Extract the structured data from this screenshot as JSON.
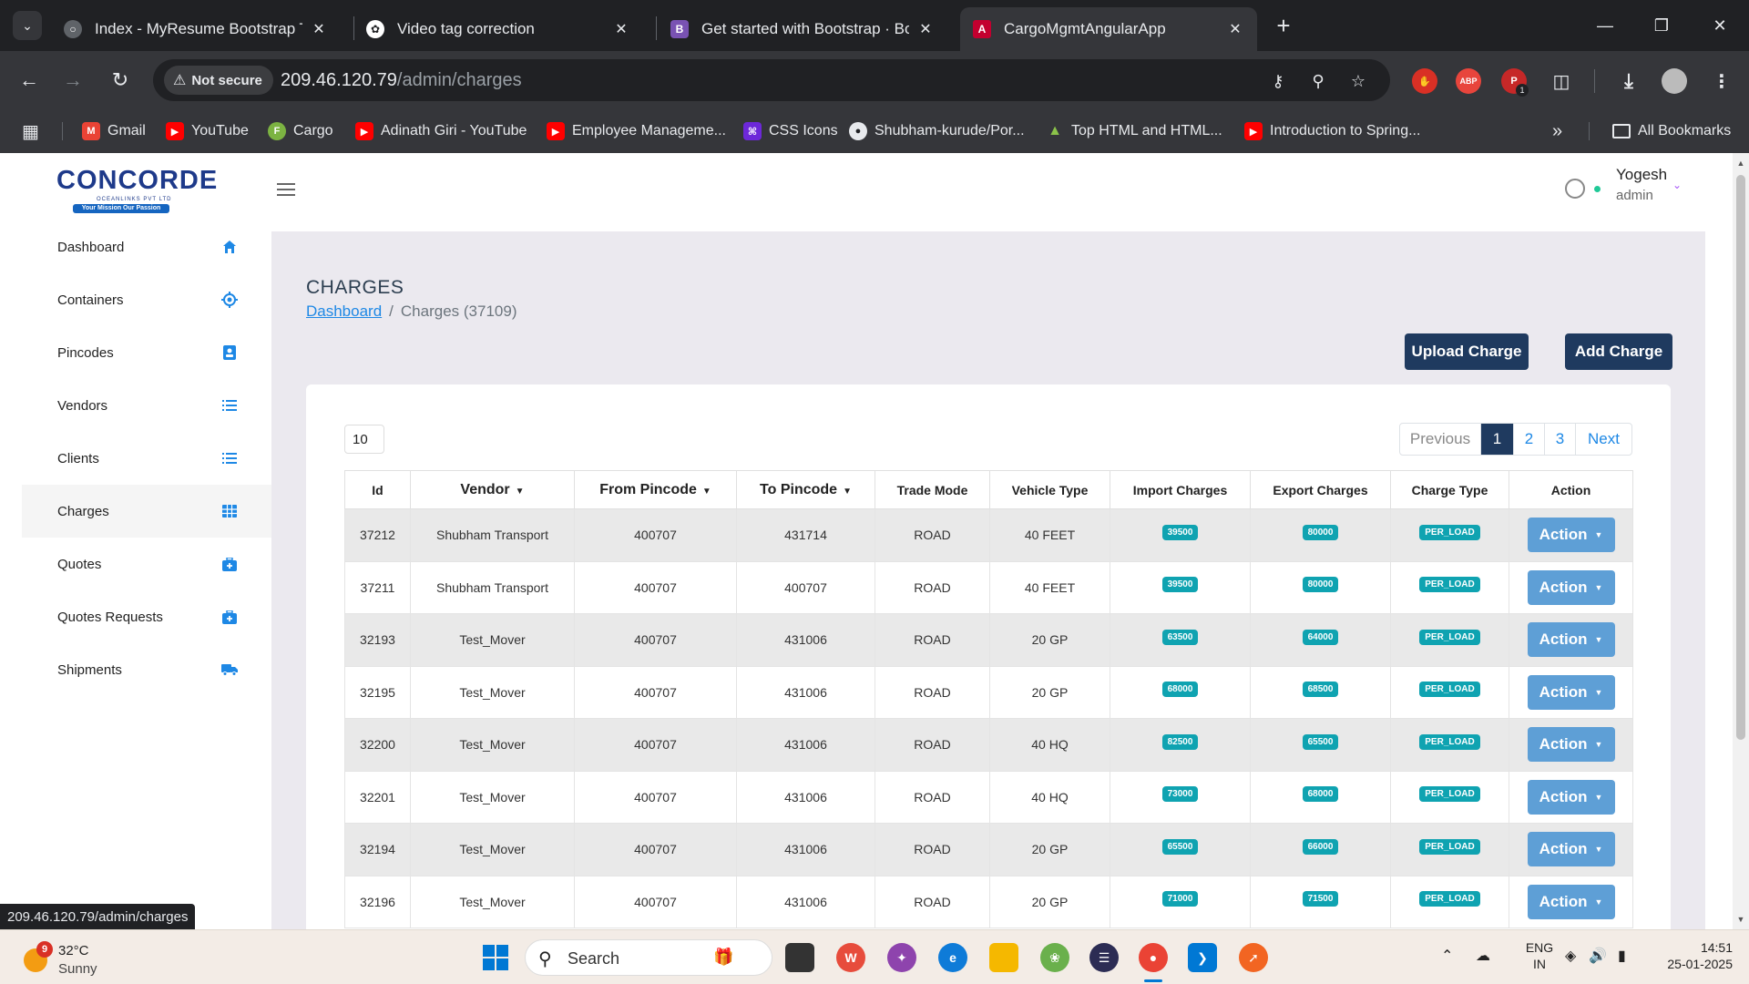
{
  "browser": {
    "tabs": [
      {
        "title": "Index - MyResume Bootstrap Temp",
        "active": false
      },
      {
        "title": "Video tag correction",
        "active": false
      },
      {
        "title": "Get started with Bootstrap · Bootst",
        "active": false
      },
      {
        "title": "CargoMgmtAngularApp",
        "active": true
      }
    ],
    "security_label": "Not secure",
    "url_host": "209.46.120.79",
    "url_path": "/admin/charges",
    "bookmarks": [
      "Gmail",
      "YouTube",
      "Cargo",
      "Adinath Giri - YouTube",
      "Employee Manageme...",
      "CSS Icons",
      "Shubham-kurude/Por...",
      "Top HTML and HTML...",
      "Introduction to Spring..."
    ],
    "all_bookmarks": "All Bookmarks",
    "extensions": {
      "abp": "ABP",
      "badge": "1"
    },
    "status_url": "209.46.120.79/admin/charges"
  },
  "app": {
    "logo": {
      "word": "CONCORDE",
      "sub": "OCEANLINKS PVT LTD",
      "tagline": "Your Mission Our Passion"
    },
    "user": {
      "name": "Yogesh",
      "role": "admin"
    },
    "sidebar": [
      {
        "label": "Dashboard",
        "icon": "home-icon"
      },
      {
        "label": "Containers",
        "icon": "target-icon"
      },
      {
        "label": "Pincodes",
        "icon": "contact-card-icon"
      },
      {
        "label": "Vendors",
        "icon": "list-icon"
      },
      {
        "label": "Clients",
        "icon": "list-icon"
      },
      {
        "label": "Charges",
        "icon": "table-icon",
        "active": true
      },
      {
        "label": "Quotes",
        "icon": "briefcase-plus-icon"
      },
      {
        "label": "Quotes Requests",
        "icon": "briefcase-plus-icon"
      },
      {
        "label": "Shipments",
        "icon": "truck-icon"
      }
    ],
    "page_title": "CHARGES",
    "breadcrumb": {
      "home": "Dashboard",
      "separator": "/",
      "current": "Charges (37109)"
    },
    "buttons": {
      "upload": "Upload Charge",
      "add": "Add Charge"
    },
    "page_size": "10",
    "pagination": {
      "previous": "Previous",
      "pages": [
        "1",
        "2",
        "3"
      ],
      "current": "1",
      "next": "Next"
    },
    "table": {
      "headers": [
        "Id",
        "Vendor",
        "From Pincode",
        "To Pincode",
        "Trade Mode",
        "Vehicle Type",
        "Import Charges",
        "Export Charges",
        "Charge Type",
        "Action"
      ],
      "rows": [
        {
          "id": "37212",
          "vendor": "Shubham Transport",
          "from": "400707",
          "to": "431714",
          "mode": "ROAD",
          "vehicle": "40 FEET",
          "import": "39500",
          "export": "80000",
          "type": "PER_LOAD"
        },
        {
          "id": "37211",
          "vendor": "Shubham Transport",
          "from": "400707",
          "to": "400707",
          "mode": "ROAD",
          "vehicle": "40 FEET",
          "import": "39500",
          "export": "80000",
          "type": "PER_LOAD"
        },
        {
          "id": "32193",
          "vendor": "Test_Mover",
          "from": "400707",
          "to": "431006",
          "mode": "ROAD",
          "vehicle": "20 GP",
          "import": "63500",
          "export": "64000",
          "type": "PER_LOAD"
        },
        {
          "id": "32195",
          "vendor": "Test_Mover",
          "from": "400707",
          "to": "431006",
          "mode": "ROAD",
          "vehicle": "20 GP",
          "import": "68000",
          "export": "68500",
          "type": "PER_LOAD"
        },
        {
          "id": "32200",
          "vendor": "Test_Mover",
          "from": "400707",
          "to": "431006",
          "mode": "ROAD",
          "vehicle": "40 HQ",
          "import": "82500",
          "export": "65500",
          "type": "PER_LOAD"
        },
        {
          "id": "32201",
          "vendor": "Test_Mover",
          "from": "400707",
          "to": "431006",
          "mode": "ROAD",
          "vehicle": "40 HQ",
          "import": "73000",
          "export": "68000",
          "type": "PER_LOAD"
        },
        {
          "id": "32194",
          "vendor": "Test_Mover",
          "from": "400707",
          "to": "431006",
          "mode": "ROAD",
          "vehicle": "20 GP",
          "import": "65500",
          "export": "66000",
          "type": "PER_LOAD"
        },
        {
          "id": "32196",
          "vendor": "Test_Mover",
          "from": "400707",
          "to": "431006",
          "mode": "ROAD",
          "vehicle": "20 GP",
          "import": "71000",
          "export": "71500",
          "type": "PER_LOAD"
        }
      ],
      "action_label": "Action"
    }
  },
  "taskbar": {
    "weather": {
      "temp": "32°C",
      "condition": "Sunny",
      "alert_count": "9"
    },
    "search_label": "Search",
    "lang": [
      "ENG",
      "IN"
    ],
    "time": "14:51",
    "date": "25-01-2025"
  },
  "colors": {
    "nav_dark": "#1f3a5f",
    "accent_blue": "#1e88e5",
    "badge_teal": "#0fa3b1",
    "action_blue": "#5e9fd6",
    "content_bg": "#ebe9ef"
  }
}
